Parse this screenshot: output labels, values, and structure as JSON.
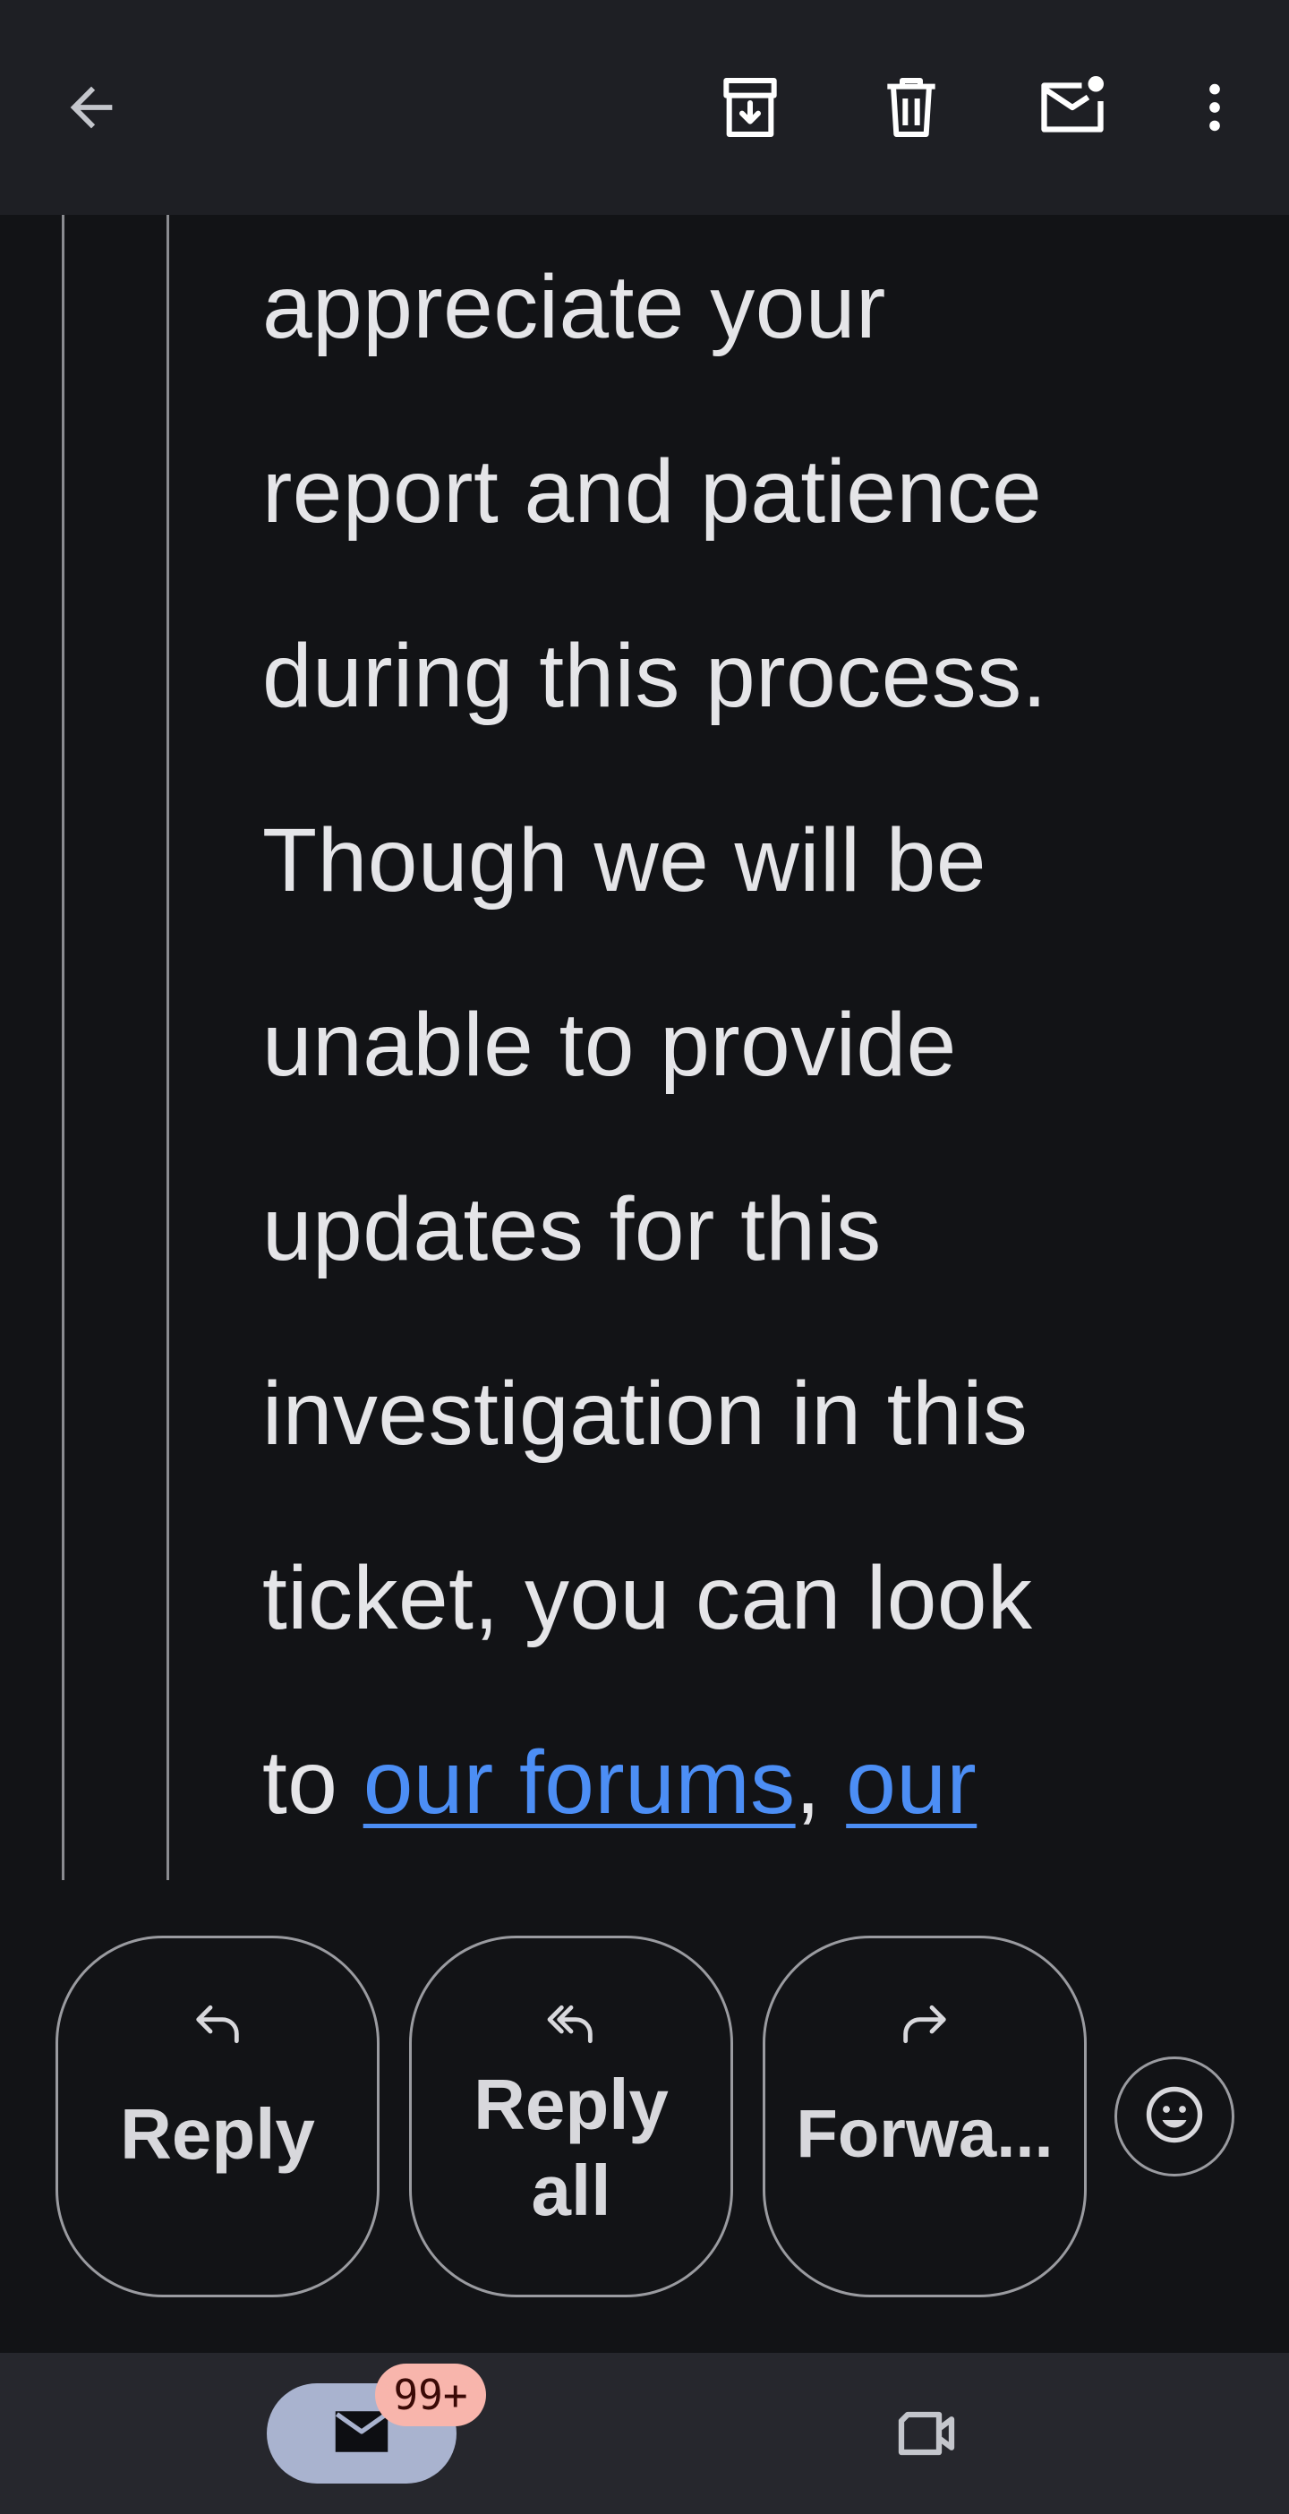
{
  "topbar": {
    "icons": [
      "back-arrow-icon",
      "archive-icon",
      "delete-icon",
      "mark-unread-icon",
      "more-vert-icon"
    ]
  },
  "message": {
    "lines": [
      "appreciate your",
      "report and patience",
      "during this process.",
      "Though we will be",
      "unable to provide",
      "updates for this",
      "investigation in this",
      "ticket, you can look"
    ],
    "last_line_prefix": "to ",
    "link1": "our forums",
    "separator": ", ",
    "link2": "our",
    "link_color": "#4c8ef5"
  },
  "actions": {
    "reply": "Reply",
    "reply_all_line1": "Reply",
    "reply_all_line2": "all",
    "forward": "Forwa..."
  },
  "bottomnav": {
    "badge": "99+",
    "items": [
      "mail-icon",
      "video-icon"
    ]
  }
}
